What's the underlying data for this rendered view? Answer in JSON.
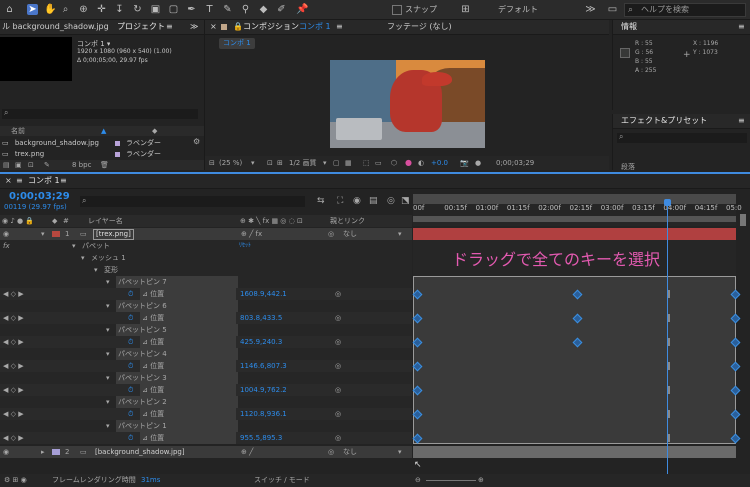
{
  "toolbar": {
    "snap_label": "スナップ",
    "workspace_label": "デフォルト",
    "help_search_placeholder": "ヘルプを検索"
  },
  "project": {
    "file_tab": "ル background_shadow.jpg",
    "panel_title": "プロジェクト",
    "comp_name": "コンポ 1 ▾",
    "comp_info1": "1920 x 1080 (960 x 540) (1.00)",
    "comp_info2": "Δ 0;00;05;00, 29.97 fps",
    "col_name": "名前",
    "items": [
      {
        "name": "background_shadow.jpg",
        "label": "ラベンダー"
      },
      {
        "name": "trex.png",
        "label": "ラベンダー"
      }
    ],
    "bpc": "8 bpc"
  },
  "composition": {
    "panel_title": "コンポジション",
    "comp_name": "コンポ 1",
    "footage_tab": "フッテージ (なし)",
    "subtab": "コンポ 1",
    "zoom": "(25 %)",
    "quality": "1/2 画質",
    "exposure": "+0.0",
    "timecode": "0;00;03;29"
  },
  "info": {
    "title": "情報",
    "r": "R :  55",
    "g": "G :  56",
    "b": "B :  55",
    "a": "A :  255",
    "x": "X :  1196",
    "y": "Y :  1073"
  },
  "effects": {
    "title": "エフェクト&プリセット",
    "preset_tab": "段落"
  },
  "timeline": {
    "comp_tab": "コンポ 1",
    "timecode": "0;00;03;29",
    "frames": "00119 (29.97 fps)",
    "col_layer_name": "レイヤー名",
    "col_parent": "親とリンク",
    "ruler": [
      "00f",
      "00:15f",
      "01:00f",
      "01:15f",
      "02:00f",
      "02:15f",
      "03:00f",
      "03:15f",
      "04:00f",
      "04:15f",
      "05:0"
    ],
    "layers": [
      {
        "num": "1",
        "name": "[trex.png]",
        "parent": "なし"
      },
      {
        "num": "2",
        "name": "[background_shadow.jpg]",
        "parent": "なし"
      }
    ],
    "puppet": "パペット",
    "reset": "ﾘｾｯﾄ",
    "mesh": "メッシュ 1",
    "deform": "変形",
    "position_label": "位置",
    "pins": [
      {
        "name": "パペットピン 7",
        "value": "1608.9,442.1"
      },
      {
        "name": "パペットピン 6",
        "value": "803.8,433.5"
      },
      {
        "name": "パペットピン 5",
        "value": "425.9,240.3"
      },
      {
        "name": "パペットピン 4",
        "value": "1146.6,807.3"
      },
      {
        "name": "パペットピン 3",
        "value": "1004.9,762.2"
      },
      {
        "name": "パペットピン 2",
        "value": "1120.8,936.1"
      },
      {
        "name": "パペットピン 1",
        "value": "955.5,895.3"
      }
    ],
    "annotation": "ドラッグで全てのキーを選択",
    "render_time": "フレームレンダリング時間",
    "render_ms": "31ms",
    "switch_mode": "スイッチ / モード"
  }
}
